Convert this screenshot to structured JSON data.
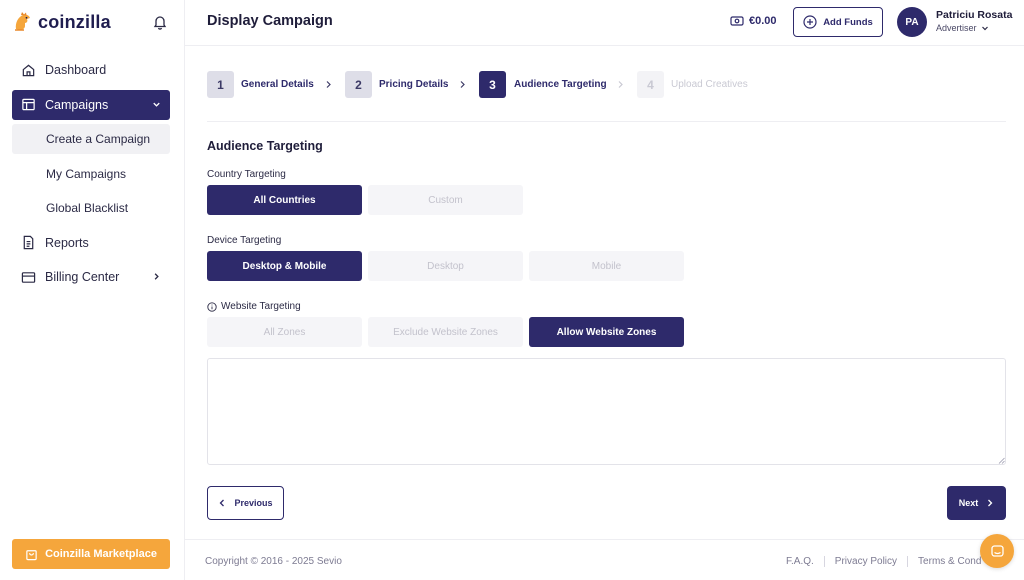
{
  "app": {
    "brand": "coinzilla"
  },
  "sidebar": {
    "items": [
      {
        "label": "Dashboard",
        "icon": "home-icon"
      },
      {
        "label": "Campaigns",
        "icon": "layout-icon",
        "active": true
      },
      {
        "label": "Reports",
        "icon": "document-icon"
      },
      {
        "label": "Billing Center",
        "icon": "card-icon"
      }
    ],
    "campaign_sub_items": [
      {
        "label": "Create a Campaign",
        "selected": true
      },
      {
        "label": "My Campaigns"
      },
      {
        "label": "Global Blacklist"
      }
    ],
    "marketplace_label": "Coinzilla Marketplace"
  },
  "header": {
    "title": "Display Campaign",
    "balance": "€0.00",
    "add_funds_label": "Add Funds",
    "user": {
      "initials": "PA",
      "name": "Patriciu Rosata",
      "role": "Advertiser"
    }
  },
  "steps": [
    {
      "number": "1",
      "label": "General Details",
      "state": "done"
    },
    {
      "number": "2",
      "label": "Pricing Details",
      "state": "done"
    },
    {
      "number": "3",
      "label": "Audience Targeting",
      "state": "current"
    },
    {
      "number": "4",
      "label": "Upload Creatives",
      "state": "pending"
    }
  ],
  "form": {
    "section_title": "Audience Targeting",
    "country": {
      "label": "Country Targeting",
      "options": [
        "All Countries",
        "Custom"
      ],
      "selected": "All Countries"
    },
    "device": {
      "label": "Device Targeting",
      "options": [
        "Desktop & Mobile",
        "Desktop",
        "Mobile"
      ],
      "selected": "Desktop & Mobile"
    },
    "website": {
      "label": "Website Targeting",
      "options": [
        "All Zones",
        "Exclude Website Zones",
        "Allow Website Zones"
      ],
      "selected": "Allow Website Zones"
    },
    "zones_textarea_value": "",
    "previous_label": "Previous",
    "next_label": "Next"
  },
  "footer": {
    "copyright": "Copyright © 2016 - 2025 Sevio",
    "links": [
      "F.A.Q.",
      "Privacy Policy",
      "Terms & Cond"
    ]
  },
  "colors": {
    "primary": "#2e2a6b",
    "accent": "#f5a63c",
    "muted": "#f5f5f8"
  }
}
